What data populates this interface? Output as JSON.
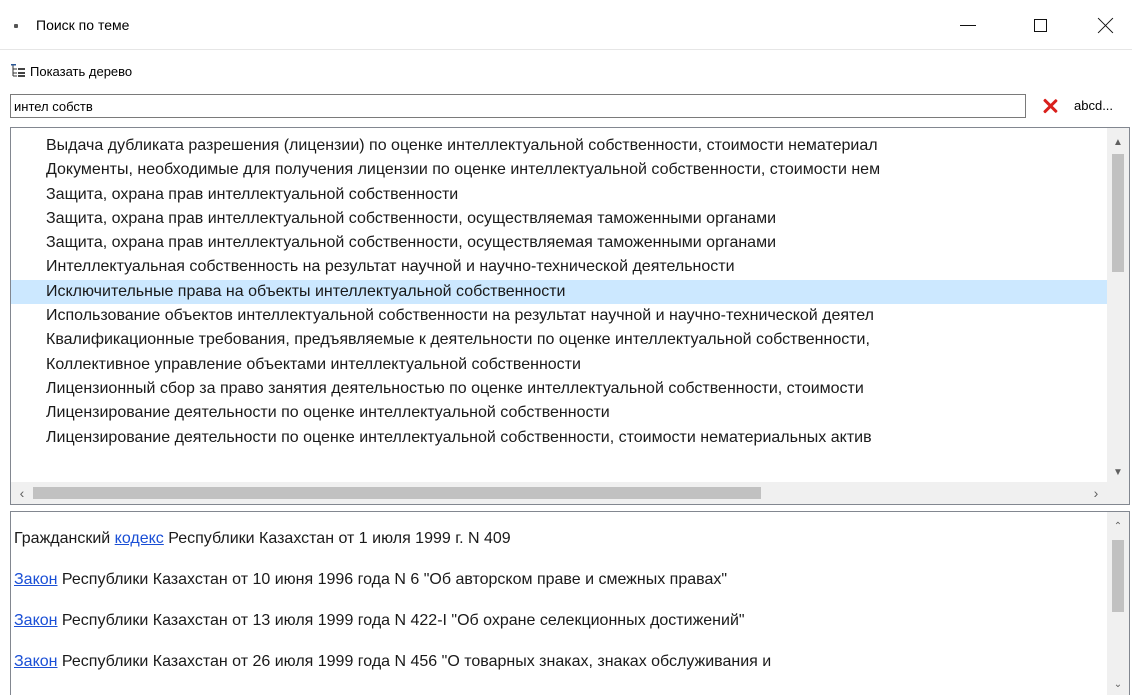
{
  "window": {
    "title": "Поиск по теме",
    "minimize_glyph": "minimize",
    "maximize_glyph": "maximize",
    "close_glyph": "close"
  },
  "toolbar": {
    "show_tree_label": "Показать дерево",
    "show_tree_icon": "tree-icon"
  },
  "search": {
    "value": "интел собств",
    "clear_icon": "red-x-icon",
    "abcd_label": "abcd..."
  },
  "topics": {
    "selected_index": 6,
    "items": [
      "Выдача дубликата разрешения (лицензии) по оценке интеллектуальной собственности, стоимости нематериал",
      "Документы, необходимые для получения лицензии по оценке интеллектуальной собственности, стоимости нем",
      "Защита, охрана прав интеллектуальной собственности",
      "Защита, охрана прав интеллектуальной собственности, осуществляемая таможенными органами",
      "Защита, охрана прав интеллектуальной собственности, осуществляемая таможенными органами",
      "Интеллектуальная собственность на результат научной и научно-технической деятельности",
      "Исключительные права на объекты интеллектуальной собственности",
      "Использование объектов интеллектуальной собственности на результат научной и научно-технической деятел",
      "Квалификационные требования, предъявляемые к деятельности по оценке интеллектуальной собственности,",
      "Коллективное управление объектами интеллектуальной собственности",
      "Лицензионный сбор за право занятия деятельностью по оценке интеллектуальной собственности, стоимости",
      "Лицензирование деятельности по оценке интеллектуальной собственности",
      "Лицензирование деятельности по оценке интеллектуальной собственности, стоимости нематериальных актив"
    ]
  },
  "documents": {
    "items": [
      {
        "prefix": "Гражданский ",
        "link": "кодекс",
        "suffix": " Республики Казахстан от 1 июля 1999 г. N 409"
      },
      {
        "prefix": "",
        "link": "Закон",
        "suffix": " Республики Казахстан от 10 июня 1996 года N 6 \"Об авторском праве и смежных правах\""
      },
      {
        "prefix": "",
        "link": "Закон",
        "suffix": " Республики Казахстан от 13 июля 1999 года N 422-I \"Об охране селекционных достижений\""
      },
      {
        "prefix": "",
        "link": "Закон",
        "suffix": " Республики Казахстан от 26 июля 1999 года N 456 \"О товарных знаках, знаках обслуживания и"
      }
    ]
  },
  "colors": {
    "selection": "#cce8ff",
    "link": "#1a4fd6",
    "clear_x": "#d9201c"
  }
}
